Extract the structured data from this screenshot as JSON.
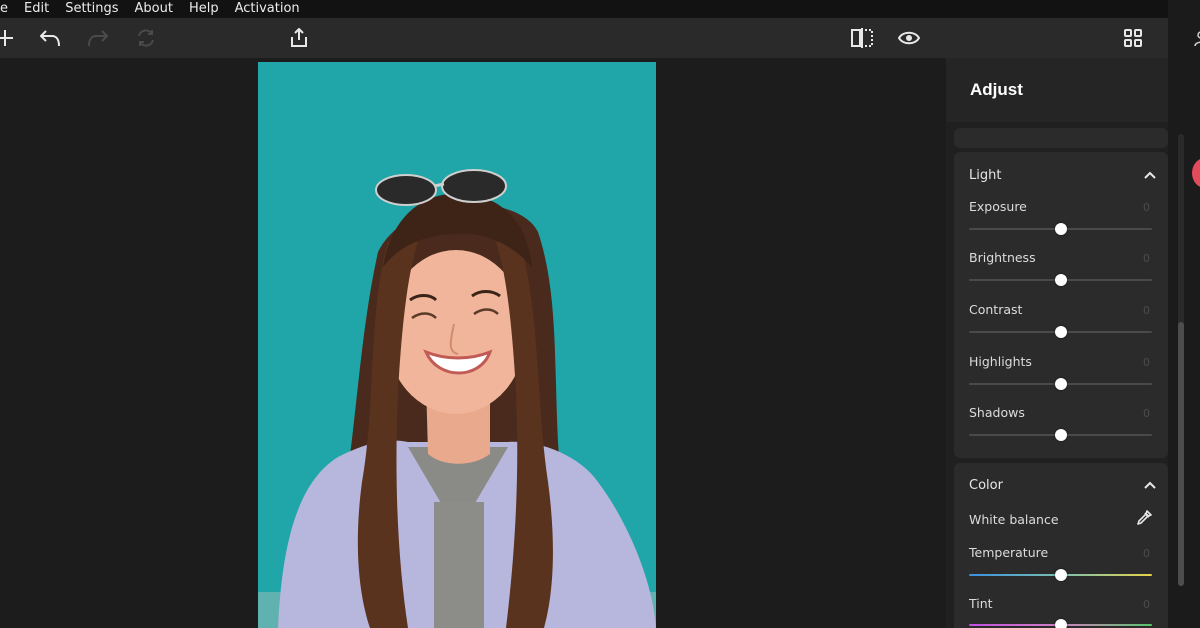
{
  "menu": {
    "items": [
      {
        "label": "e"
      },
      {
        "label": "Edit"
      },
      {
        "label": "Settings"
      },
      {
        "label": "About"
      },
      {
        "label": "Help"
      },
      {
        "label": "Activation"
      }
    ]
  },
  "toolbar": {
    "icons": [
      "add-icon",
      "undo-icon",
      "redo-icon",
      "reset-icon",
      "export-icon",
      "compare-icon",
      "preview-eye-icon",
      "grid-view-icon"
    ],
    "redo_enabled": false,
    "reset_enabled": false
  },
  "panel": {
    "title": "Adjust",
    "light": {
      "title": "Light",
      "rows": [
        {
          "label": "Exposure",
          "value": "0",
          "level": 0.5
        },
        {
          "label": "Brightness",
          "value": "0",
          "level": 0.5
        },
        {
          "label": "Contrast",
          "value": "0",
          "level": 0.5
        },
        {
          "label": "Highlights",
          "value": "0",
          "level": 0.5
        },
        {
          "label": "Shadows",
          "value": "0",
          "level": 0.5
        }
      ]
    },
    "color": {
      "title": "Color",
      "white_balance": "White balance",
      "rows": [
        {
          "label": "Temperature",
          "value": "0",
          "level": 0.5
        },
        {
          "label": "Tint",
          "value": "0",
          "level": 0.5
        }
      ]
    }
  },
  "colors": {
    "photo_background": "#20a6a8",
    "accent_dot": "#e14b5c"
  }
}
